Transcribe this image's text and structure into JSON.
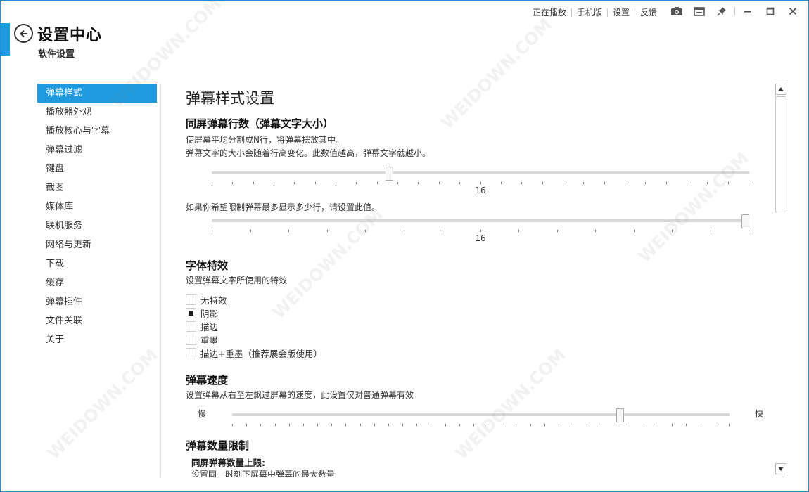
{
  "topbar": {
    "links": [
      "正在播放",
      "手机版",
      "设置",
      "反馈"
    ],
    "icons": [
      "camera-icon",
      "mini-mode-icon",
      "pin-icon",
      "minimize-icon",
      "maximize-icon",
      "close-icon"
    ]
  },
  "header": {
    "title": "设置中心",
    "subtitle": "软件设置",
    "accent_color": "#1e9be0"
  },
  "sidebar": {
    "items": [
      {
        "label": "弹幕样式",
        "active": true
      },
      {
        "label": "播放器外观"
      },
      {
        "label": "播放核心与字幕"
      },
      {
        "label": "弹幕过滤"
      },
      {
        "label": "键盘"
      },
      {
        "label": "截图"
      },
      {
        "label": "媒体库"
      },
      {
        "label": "联机服务"
      },
      {
        "label": "网络与更新"
      },
      {
        "label": "下载"
      },
      {
        "label": "缓存"
      },
      {
        "label": "弹幕插件"
      },
      {
        "label": "文件关联"
      },
      {
        "label": "关于"
      }
    ]
  },
  "main": {
    "section_title": "弹幕样式设置",
    "lines": {
      "heading": "同屏弹幕行数（弹幕文字大小）",
      "desc1": "使屏幕平均分割成N行，将弹幕摆放其中。",
      "desc2": "弹幕文字的大小会随着行高变化。此数值越高，弹幕文字就越小。",
      "slider1_value": "16",
      "slider1_position": 0.33,
      "limit_desc": "如果你希望限制弹幕最多显示多少行，请设置此值。",
      "slider2_value": "16",
      "slider2_position": 1.0
    },
    "font_effect": {
      "heading": "字体特效",
      "desc": "设置弹幕文字所使用的特效",
      "options": [
        {
          "label": "无特效",
          "checked": false
        },
        {
          "label": "阴影",
          "checked": true
        },
        {
          "label": "描边",
          "checked": false
        },
        {
          "label": "重墨",
          "checked": false
        },
        {
          "label": "描边+重墨（推荐展会版使用）",
          "checked": false
        }
      ]
    },
    "speed": {
      "heading": "弹幕速度",
      "desc": "设置弹幕从右至左飘过屏幕的速度，此设置仅对普通弹幕有效",
      "slow_label": "慢",
      "fast_label": "快",
      "position": 0.78
    },
    "count_limit": {
      "heading": "弹幕数量限制",
      "subheading": "同屏弹幕数量上限:",
      "desc": "设置同一时刻下屏幕中弹幕的最大数量"
    }
  },
  "watermark": "WEIDOWN.COM"
}
